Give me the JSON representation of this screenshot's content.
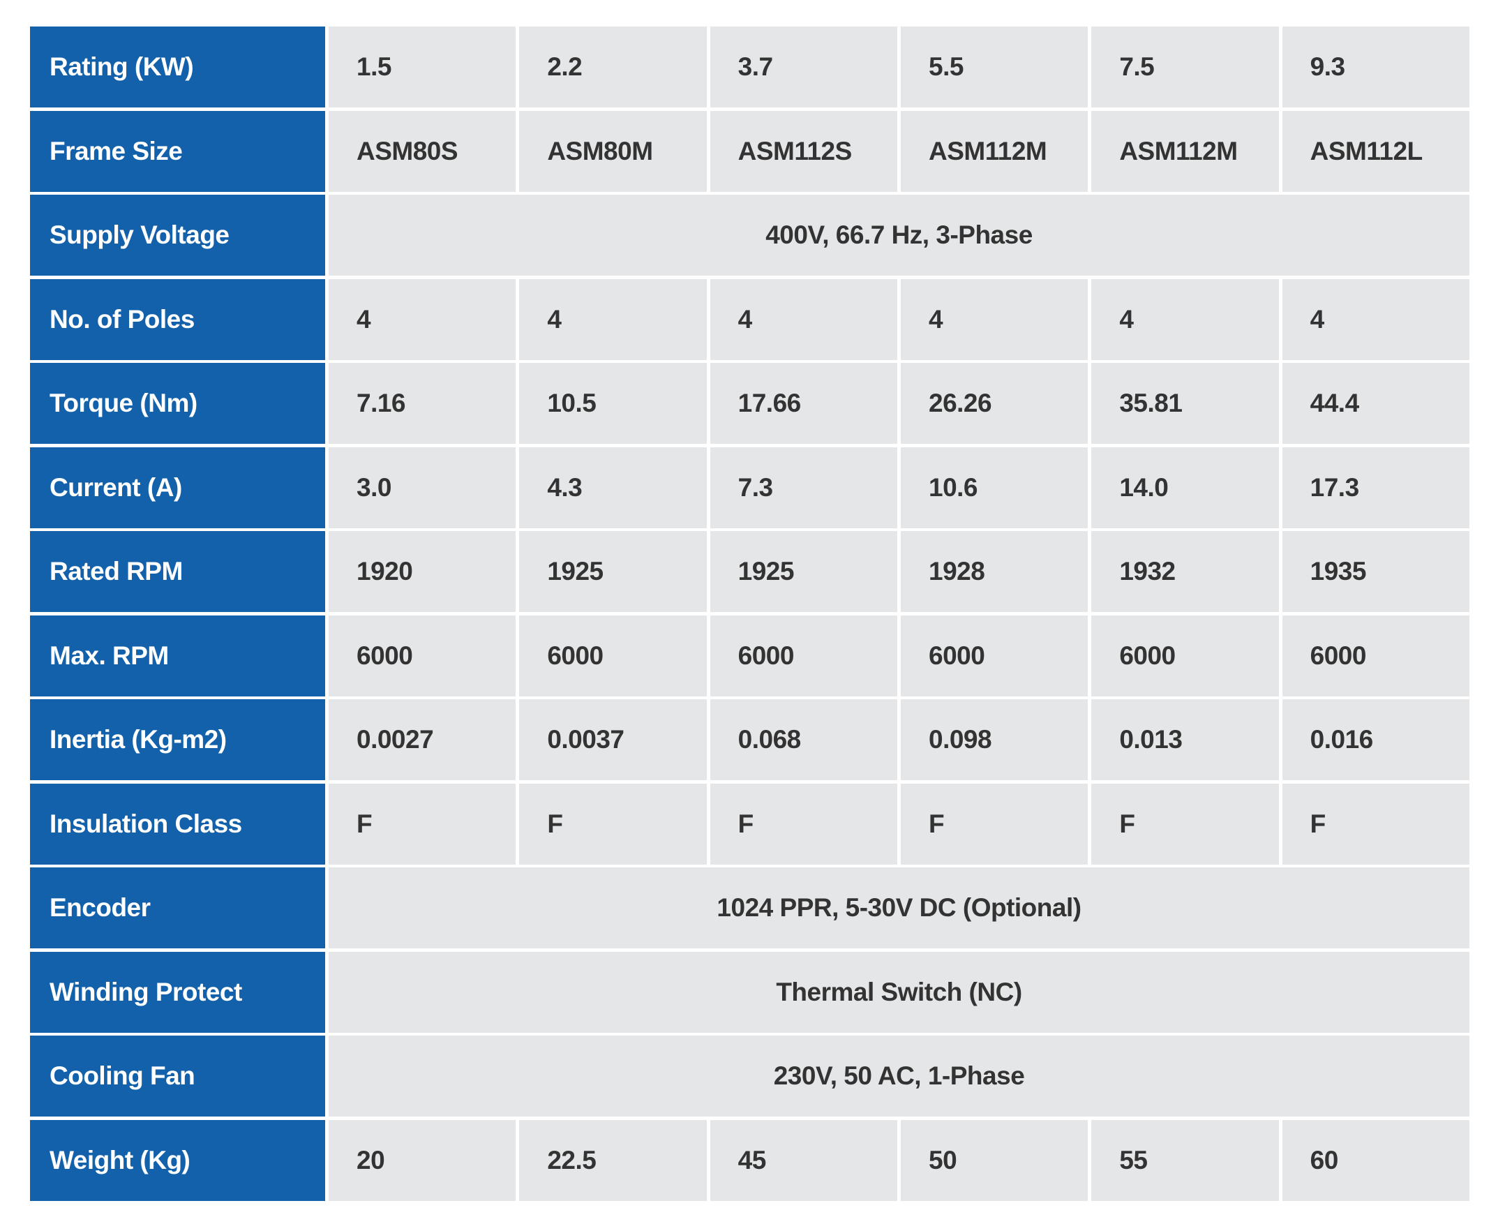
{
  "colors": {
    "header_bg": "#1361AA",
    "cell_bg": "#E5E6E7",
    "text_dark": "#333333",
    "header_text": "#FFFFFF"
  },
  "rows": [
    {
      "label": "Rating (KW)",
      "values": [
        "1.5",
        "2.2",
        "3.7",
        "5.5",
        "7.5",
        "9.3"
      ]
    },
    {
      "label": "Frame Size",
      "values": [
        "ASM80S",
        "ASM80M",
        "ASM112S",
        "ASM112M",
        "ASM112M",
        "ASM112L"
      ]
    },
    {
      "label": "Supply Voltage",
      "merged": "400V, 66.7 Hz, 3-Phase"
    },
    {
      "label": "No. of Poles",
      "values": [
        "4",
        "4",
        "4",
        "4",
        "4",
        "4"
      ]
    },
    {
      "label": "Torque (Nm)",
      "values": [
        "7.16",
        "10.5",
        "17.66",
        "26.26",
        "35.81",
        "44.4"
      ]
    },
    {
      "label": "Current (A)",
      "values": [
        "3.0",
        "4.3",
        "7.3",
        "10.6",
        "14.0",
        "17.3"
      ]
    },
    {
      "label": "Rated RPM",
      "values": [
        "1920",
        "1925",
        "1925",
        "1928",
        "1932",
        "1935"
      ]
    },
    {
      "label": "Max. RPM",
      "values": [
        "6000",
        "6000",
        "6000",
        "6000",
        "6000",
        "6000"
      ]
    },
    {
      "label": "Inertia (Kg-m2)",
      "values": [
        "0.0027",
        "0.0037",
        "0.068",
        "0.098",
        "0.013",
        "0.016"
      ]
    },
    {
      "label": "Insulation Class",
      "values": [
        "F",
        "F",
        "F",
        "F",
        "F",
        "F"
      ]
    },
    {
      "label": "Encoder",
      "merged": "1024 PPR, 5-30V DC (Optional)"
    },
    {
      "label": "Winding Protect",
      "merged": "Thermal Switch (NC)"
    },
    {
      "label": "Cooling Fan",
      "merged": "230V, 50 AC, 1-Phase"
    },
    {
      "label": "Weight (Kg)",
      "values": [
        "20",
        "22.5",
        "45",
        "50",
        "55",
        "60"
      ]
    }
  ]
}
